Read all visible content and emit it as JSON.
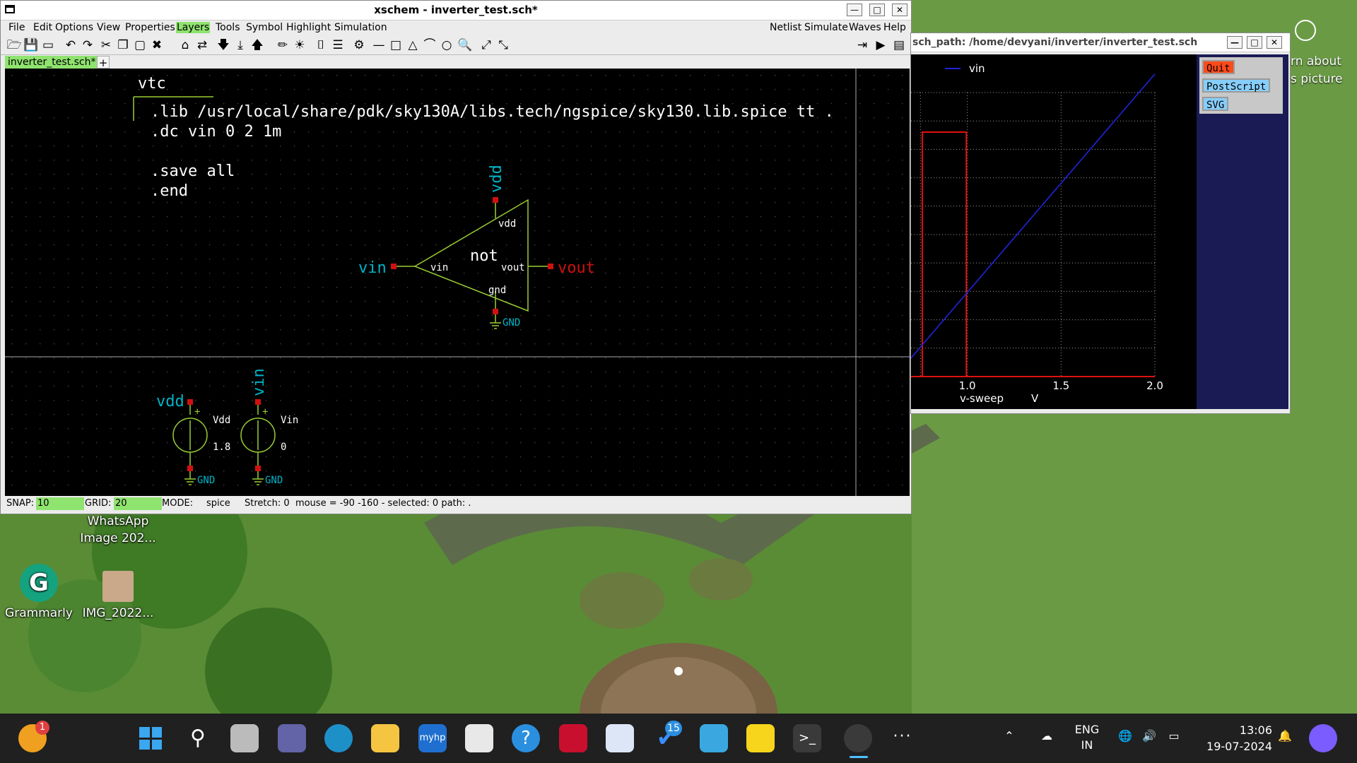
{
  "desktop": {
    "icons": [
      {
        "label_line1": "WhatsApp",
        "label_line2": "Image 202..."
      },
      {
        "label": "Grammarly"
      },
      {
        "label": "IMG_2022..."
      }
    ],
    "partial_text_line1": "rn about",
    "partial_text_line2": "s picture"
  },
  "xschem": {
    "title": "xschem - inverter_test.sch*",
    "menu_left": [
      "File",
      "Edit",
      "Options",
      "View",
      "Properties",
      "Layers",
      "Tools",
      "Symbol",
      "Highlight",
      "Simulation"
    ],
    "menu_right": [
      "Netlist",
      "Simulate",
      "Waves",
      "Help"
    ],
    "tab_label": "inverter_test.sch*",
    "tab_add": "+",
    "schematic": {
      "code_title": "vtc",
      "code_lines": [
        ".lib /usr/local/share/pdk/sky130A/libs.tech/ngspice/sky130.lib.spice tt .",
        ".dc vin 0 2 1m",
        ".save all",
        ".end"
      ],
      "inverter": {
        "name": "not",
        "pin_vdd": "vdd",
        "pin_vin": "vin",
        "pin_vout": "vout",
        "pin_gnd": "gnd",
        "net_vdd": "vdd",
        "net_vin": "vin",
        "net_vout": "vout",
        "net_gnd": "GND"
      },
      "sources": [
        {
          "net": "vdd",
          "name": "Vdd",
          "value": "1.8",
          "gnd": "GND",
          "plus": "+"
        },
        {
          "net": "vin",
          "name": "Vin",
          "value": "0",
          "gnd": "GND",
          "plus": "+"
        }
      ]
    },
    "status": {
      "snap_label": "SNAP:",
      "snap_value": "10",
      "grid_label": "GRID:",
      "grid_value": "20",
      "mode_label": "MODE:",
      "mode_value": "spice",
      "info": "Stretch: 0  mouse = -90 -160 - selected: 0 path: ."
    }
  },
  "waves": {
    "title": "sch_path: /home/devyani/inverter/inverter_test.sch",
    "legend": "vin",
    "x_ticks": [
      "1.0",
      "1.5",
      "2.0"
    ],
    "x_label": "v-sweep",
    "x_unit": "V",
    "buttons": {
      "quit": "Quit",
      "postscript": "PostScript",
      "svg": "SVG"
    }
  },
  "chart_data": {
    "type": "line",
    "series": [
      {
        "name": "vin",
        "x": [
          0.0,
          2.0
        ],
        "y": [
          0.0,
          2.0
        ]
      }
    ],
    "xlabel": "v-sweep",
    "xunit": "V",
    "xlim": [
      0.7,
      2.0
    ],
    "x_ticks": [
      1.0,
      1.5,
      2.0
    ],
    "grid": true,
    "legend": "top-left"
  },
  "taskbar": {
    "notif_badge": "1",
    "todo_badge": "15",
    "myhp": "myhp",
    "lang_line1": "ENG",
    "lang_line2": "IN",
    "time": "13:06",
    "date": "19-07-2024",
    "more": "···"
  },
  "colors": {
    "canvas": "#000000",
    "wire": "#9acd32",
    "net_label": "#00b4c8",
    "pin_red": "#d01010",
    "layers_highlight": "#8fe36f",
    "wave_blue": "#2222dd"
  }
}
